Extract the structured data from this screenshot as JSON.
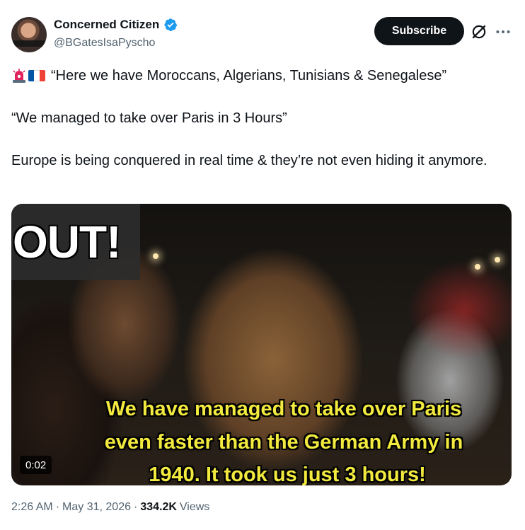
{
  "author": {
    "display_name": "Concerned Citizen",
    "handle": "@BGatesIsaPyscho",
    "verified": true,
    "verified_color": "#1d9bf0"
  },
  "actions": {
    "subscribe_label": "Subscribe",
    "grok_icon": "grok-icon",
    "more_icon": "more-icon"
  },
  "post": {
    "emoji_prefix": [
      "siren-emoji",
      "france-flag-emoji"
    ],
    "line1": "“Here we have Moroccans, Algerians, Tunisians & Senegalese”",
    "line2": "“We managed to take over Paris in 3 Hours”",
    "line3": "Europe is being conquered in real time & they’re not even hiding it anymore."
  },
  "media": {
    "overlay_text": "OUT!",
    "subtitle_line1": "We have managed to take over Paris",
    "subtitle_line2": "even faster than the German Army in",
    "subtitle_line3": "1940. It took us just 3 hours!",
    "duration": "0:02"
  },
  "footer": {
    "time": "2:26 AM",
    "separator": "·",
    "date": "May 31, 2026",
    "views_count": "334.2K",
    "views_label": "Views"
  }
}
